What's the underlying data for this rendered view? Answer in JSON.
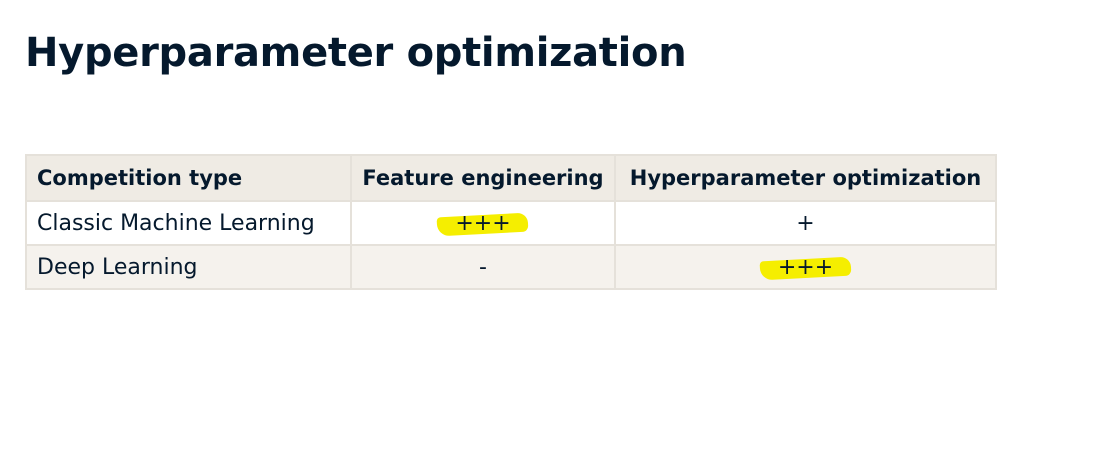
{
  "page": {
    "title": "Hyperparameter optimization"
  },
  "table": {
    "headers": [
      "Competition type",
      "Feature engineering",
      "Hyperparameter optimization"
    ],
    "rows": [
      {
        "cells": [
          "Classic Machine Learning",
          "+++",
          "+"
        ],
        "highlighted_cell": 1
      },
      {
        "cells": [
          "Deep Learning",
          "-",
          "+++"
        ],
        "highlighted_cell": 2
      }
    ]
  },
  "colors": {
    "title_text": "#05192d",
    "header_bg": "#efebe4",
    "alt_row_bg": "#f5f2ed",
    "highlight": "#f5ee00"
  }
}
